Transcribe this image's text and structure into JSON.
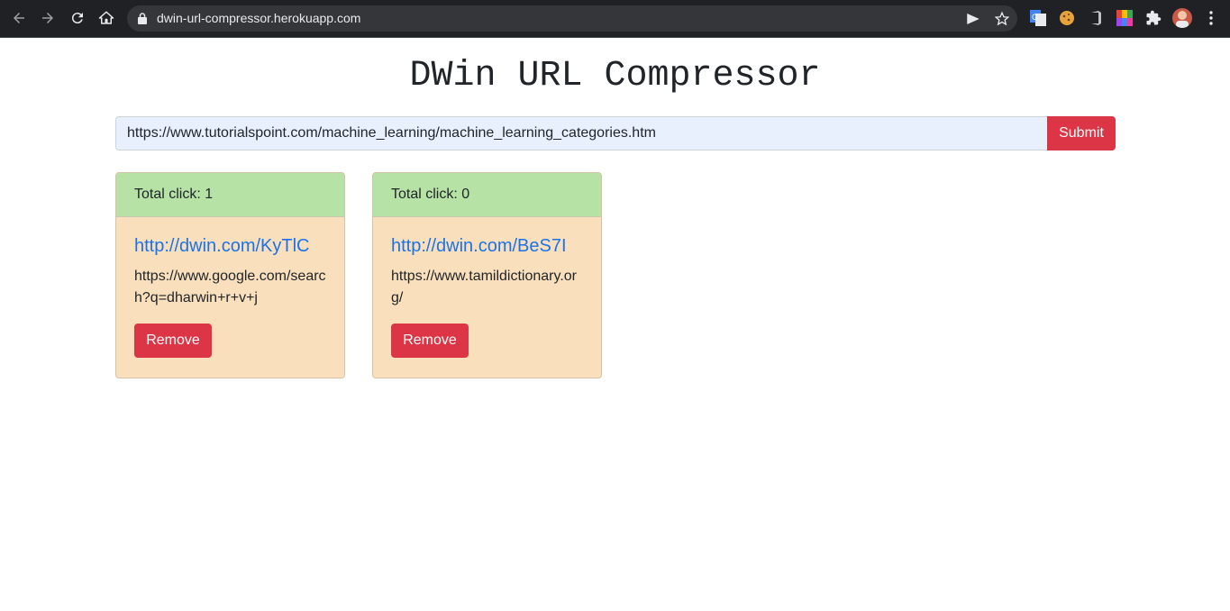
{
  "browser": {
    "url": "dwin-url-compressor.herokuapp.com"
  },
  "page": {
    "title": "DWin URL Compressor"
  },
  "form": {
    "input_value": "https://www.tutorialspoint.com/machine_learning/machine_learning_categories.htm",
    "submit_label": "Submit"
  },
  "cards": [
    {
      "clicks": "Total click: 1",
      "short_url": "http://dwin.com/KyTlC",
      "original_url": "https://www.google.com/search?q=dharwin+r+v+j",
      "remove_label": "Remove"
    },
    {
      "clicks": "Total click: 0",
      "short_url": "http://dwin.com/BeS7I",
      "original_url": "https://www.tamildictionary.org/",
      "remove_label": "Remove"
    }
  ],
  "colors": {
    "card_header": "#b6e2a6",
    "card_body": "#f9dfbc",
    "danger": "#dc3545",
    "link": "#1a73e8",
    "chrome_bg": "#202124"
  },
  "icons": [
    "back-icon",
    "forward-icon",
    "reload-icon",
    "home-icon",
    "lock-icon",
    "send-icon",
    "star-icon",
    "translate-extension-icon",
    "cookie-extension-icon",
    "office-extension-icon",
    "color-extension-icon",
    "puzzle-icon",
    "avatar",
    "kebab-menu-icon"
  ]
}
